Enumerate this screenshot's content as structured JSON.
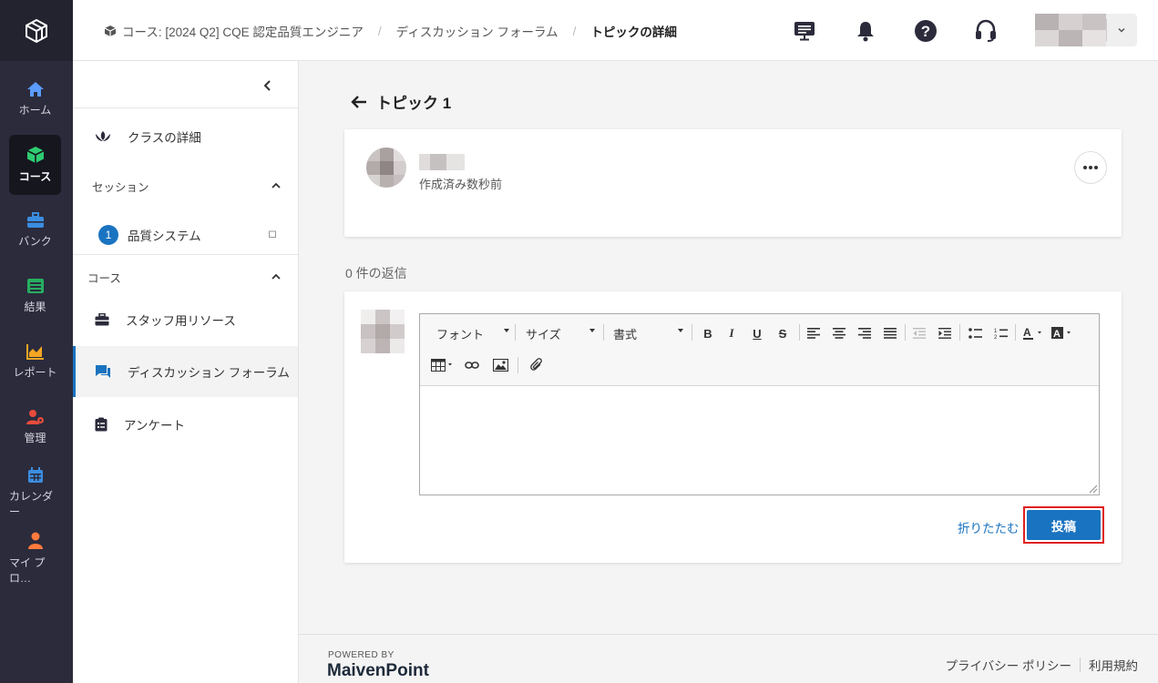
{
  "nav": {
    "items": [
      {
        "label": "ホーム",
        "icon": "home-icon"
      },
      {
        "label": "コース",
        "icon": "cube-icon",
        "active": true
      },
      {
        "label": "バンク",
        "icon": "toolbox-icon"
      },
      {
        "label": "結果",
        "icon": "list-icon"
      },
      {
        "label": "レポート",
        "icon": "chart-icon"
      },
      {
        "label": "管理",
        "icon": "user-gear-icon"
      },
      {
        "label": "カレンダー",
        "icon": "calendar-icon"
      },
      {
        "label": "マイ プロ…",
        "icon": "person-icon"
      }
    ]
  },
  "header": {
    "breadcrumb": [
      "コース: [2024 Q2] CQE 認定品質エンジニア",
      "ディスカッション フォーラム",
      "トピックの詳細"
    ]
  },
  "sidebar": {
    "class_details": "クラスの詳細",
    "session_section": "セッション",
    "session_number": "1",
    "session_item": "品質システム",
    "course_section": "コース",
    "items": [
      "スタッフ用リソース",
      "ディスカッション フォーラム",
      "アンケート"
    ]
  },
  "topic": {
    "title": "トピック 1",
    "created": "作成済み数秒前"
  },
  "replies": "0 件の返信",
  "editor": {
    "font_label": "フォント",
    "size_label": "サイズ",
    "format_label": "書式",
    "bold": "B",
    "italic": "I",
    "underline": "U",
    "strike": "S"
  },
  "actions": {
    "fold": "折りたたむ",
    "post": "投稿"
  },
  "footer": {
    "powered": "POWERED BY",
    "brand": "MaivenPoint",
    "privacy": "プライバシー ポリシー",
    "terms": "利用規約"
  },
  "colors": {
    "accent": "#1a73c0",
    "rail": "#2b2b3c",
    "highlight": "#e02020"
  }
}
